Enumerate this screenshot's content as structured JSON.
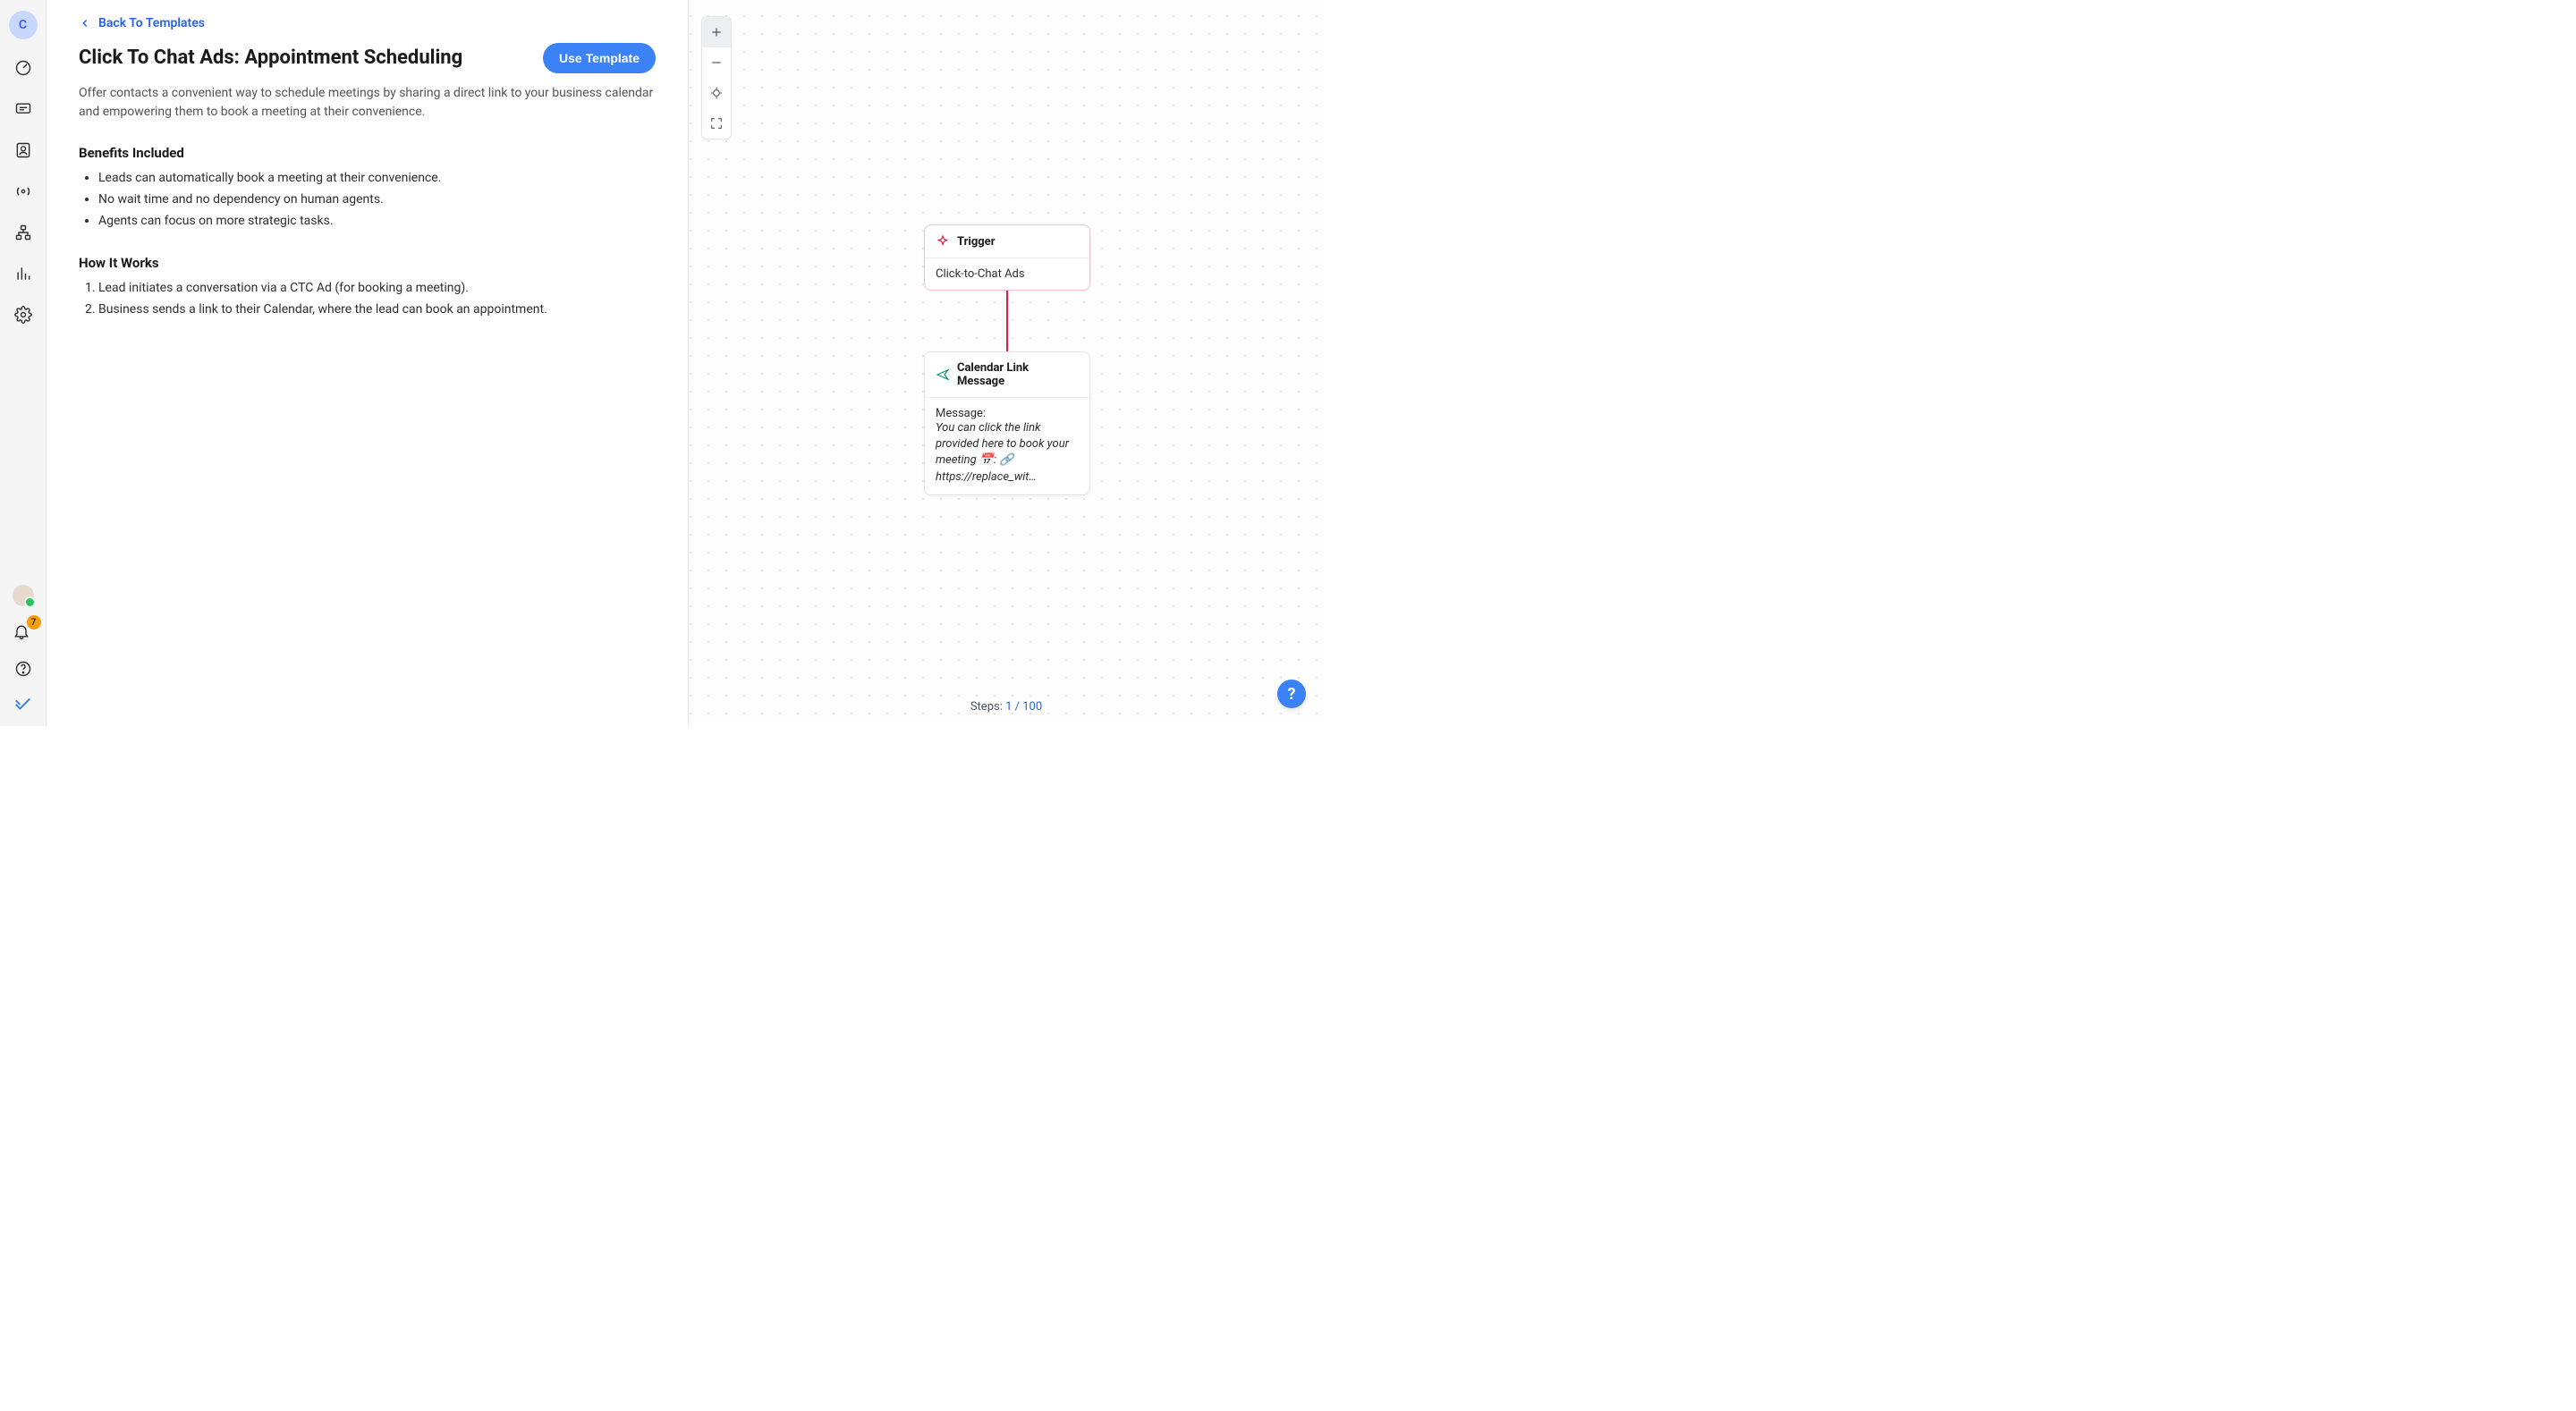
{
  "sidebar": {
    "workspace_initial": "C",
    "notification_count": "7"
  },
  "template": {
    "back_label": "Back To Templates",
    "title": "Click To Chat Ads: Appointment Scheduling",
    "use_button": "Use Template",
    "description": "Offer contacts a convenient way to schedule meetings by sharing a direct link to your business calendar and empowering them to book a meeting at their convenience.",
    "benefits_heading": "Benefits Included",
    "benefits": [
      "Leads can automatically book a meeting at their convenience.",
      "No wait time and no dependency on human agents.",
      "Agents can focus on more strategic tasks."
    ],
    "how_heading": "How It Works",
    "how_steps": [
      "Lead initiates a conversation via a CTC Ad (for booking a meeting).",
      "Business sends a link to their Calendar, where the lead can book an appointment."
    ]
  },
  "canvas": {
    "steps_label": "Steps:",
    "steps_current": "1",
    "steps_max": "100",
    "trigger": {
      "heading": "Trigger",
      "body": "Click-to-Chat Ads"
    },
    "message_node": {
      "heading": "Calendar Link Message",
      "label": "Message:",
      "body": "You can click the link provided here to book your meeting 📅: 🔗 https://replace_wit…"
    }
  },
  "help": {
    "label": "?"
  }
}
